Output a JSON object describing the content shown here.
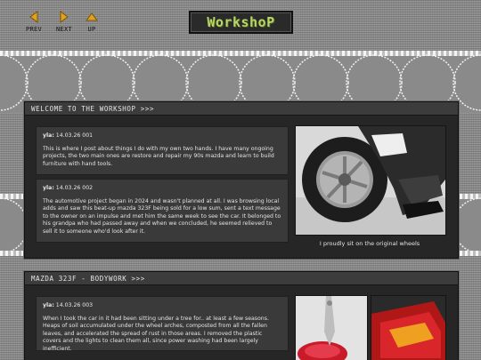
{
  "nav": {
    "prev_label": "PREV",
    "next_label": "NEXT",
    "up_label": "UP"
  },
  "logo": {
    "text": "WorkshoP"
  },
  "sections": [
    {
      "title": "WELCOME TO THE WORKSHOP >>>",
      "posts": [
        {
          "author": "yla:",
          "date": "14.03.26 001",
          "text": "This is where I post about things I do with my own two hands. I have many ongoing projects, the two main ones are restore and repair my 90s mazda and learn to build furniture with hand tools."
        },
        {
          "author": "yla:",
          "date": "14.03.26 002",
          "text": "The automotive project began in 2024 and wasn't planned at all. I was browsing local adds and saw this beat-up mazda 323F being sold for a low sum, sent a text message to the owner on an impulse and met him the same week to see the car. It belonged to his grandpa who had passed away and when we concluded, he seemed relieved to sell it to someone who'd look after it."
        }
      ],
      "photo_caption": "I proudly sit on the original wheels"
    },
    {
      "title": "MAZDA 323F - BODYWORK >>>",
      "posts": [
        {
          "author": "yla:",
          "date": "14.03.26 003",
          "text": "When I took the car in it had been sitting under a tree for.. at least a few seasons. Heaps of soil accumulated under the wheel arches, composted from all the fallen leaves, and accelerated the spread of rust in those areas. I removed the plastic covers and the lights to clean them all, since power washing had been largely inefficient."
        }
      ]
    }
  ],
  "colors": {
    "logo_text": "#b8d66a",
    "panel_bg": "#262626",
    "post_bg": "#3a3a3a",
    "nav_arrow": "#e0a020"
  },
  "icons": [
    "prev-arrow-icon",
    "next-arrow-icon",
    "up-arrow-icon"
  ]
}
